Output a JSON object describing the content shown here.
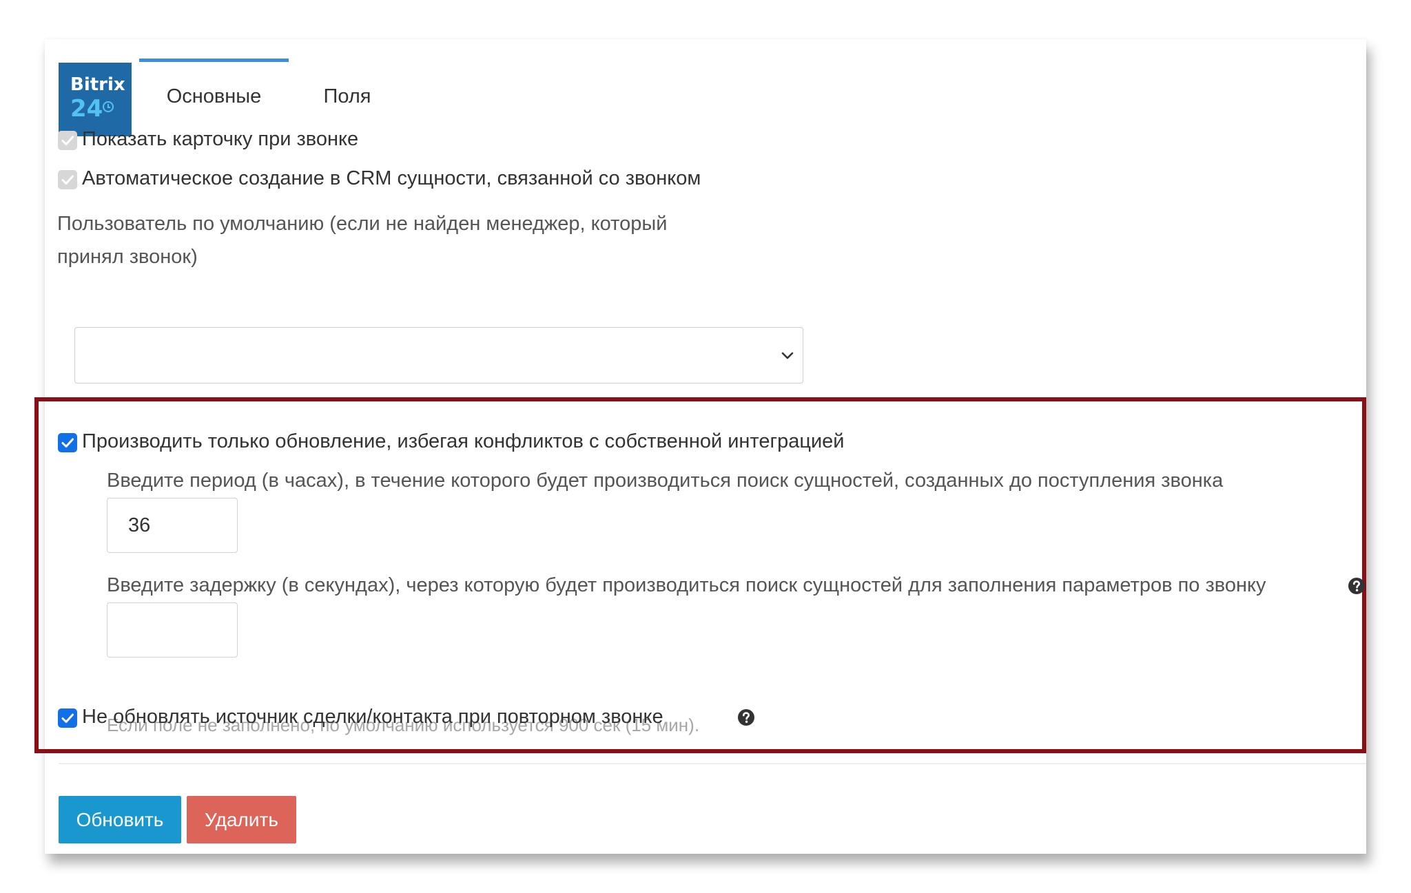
{
  "logo": {
    "line1": "Bitrix",
    "line2": "24"
  },
  "tabs": [
    {
      "label": "Основные",
      "active": true
    },
    {
      "label": "Поля",
      "active": false
    }
  ],
  "options": {
    "show_card": {
      "label": "Показать карточку при звонке",
      "checked": true,
      "disabled": true
    },
    "auto_create": {
      "label": "Автоматическое создание в CRM сущности, связанной со звонком",
      "checked": true,
      "disabled": true
    }
  },
  "default_user": {
    "label_line1": "Пользователь по умолчанию (если не найден менеджер, который",
    "label_line2": "принял звонок)",
    "value": ""
  },
  "update_only": {
    "label": "Производить только обновление, избегая конфликтов с собственной интеграцией",
    "checked": true,
    "period": {
      "label": "Введите период (в часах), в течение которого будет производиться поиск сущностей, созданных до поступления звонка",
      "value": "36"
    },
    "delay": {
      "label": "Введите задержку (в секундах), через которую будет производиться поиск сущностей для заполнения параметров по звонку",
      "value": "",
      "hint": "Если поле не заполнено, по умолчанию используется 900 сек (15 мин)."
    }
  },
  "no_update_source": {
    "label": "Не обновлять источник сделки/контакта при повторном звонке",
    "checked": true
  },
  "buttons": {
    "update": "Обновить",
    "delete": "Удалить"
  },
  "colors": {
    "accent": "#1898cf",
    "danger": "#dd6458",
    "highlight_border": "#8b0e14",
    "checkbox_checked": "#1170e8"
  }
}
